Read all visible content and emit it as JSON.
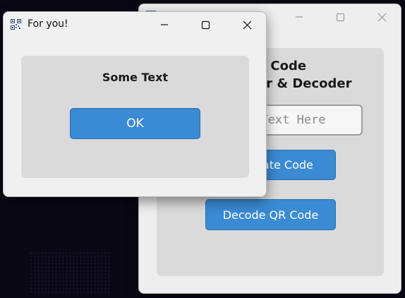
{
  "main_window": {
    "heading_line1": "QR Code",
    "heading_line2": "Encoder & Decoder",
    "input_placeholder": "Enter Text Here",
    "generate_button": "Generate Code",
    "decode_button": "Decode QR Code"
  },
  "dialog": {
    "title": "For you!",
    "message": "Some Text",
    "ok_button": "OK"
  },
  "icons": {
    "minimize": "minimize-icon",
    "maximize": "maximize-icon",
    "close": "close-icon",
    "app": "qr-app-icon"
  },
  "colors": {
    "button_blue": "#3a8ad4",
    "panel_gray": "#dadada",
    "window_bg": "#f0f0f0",
    "desktop_bg": "#0b0816"
  }
}
